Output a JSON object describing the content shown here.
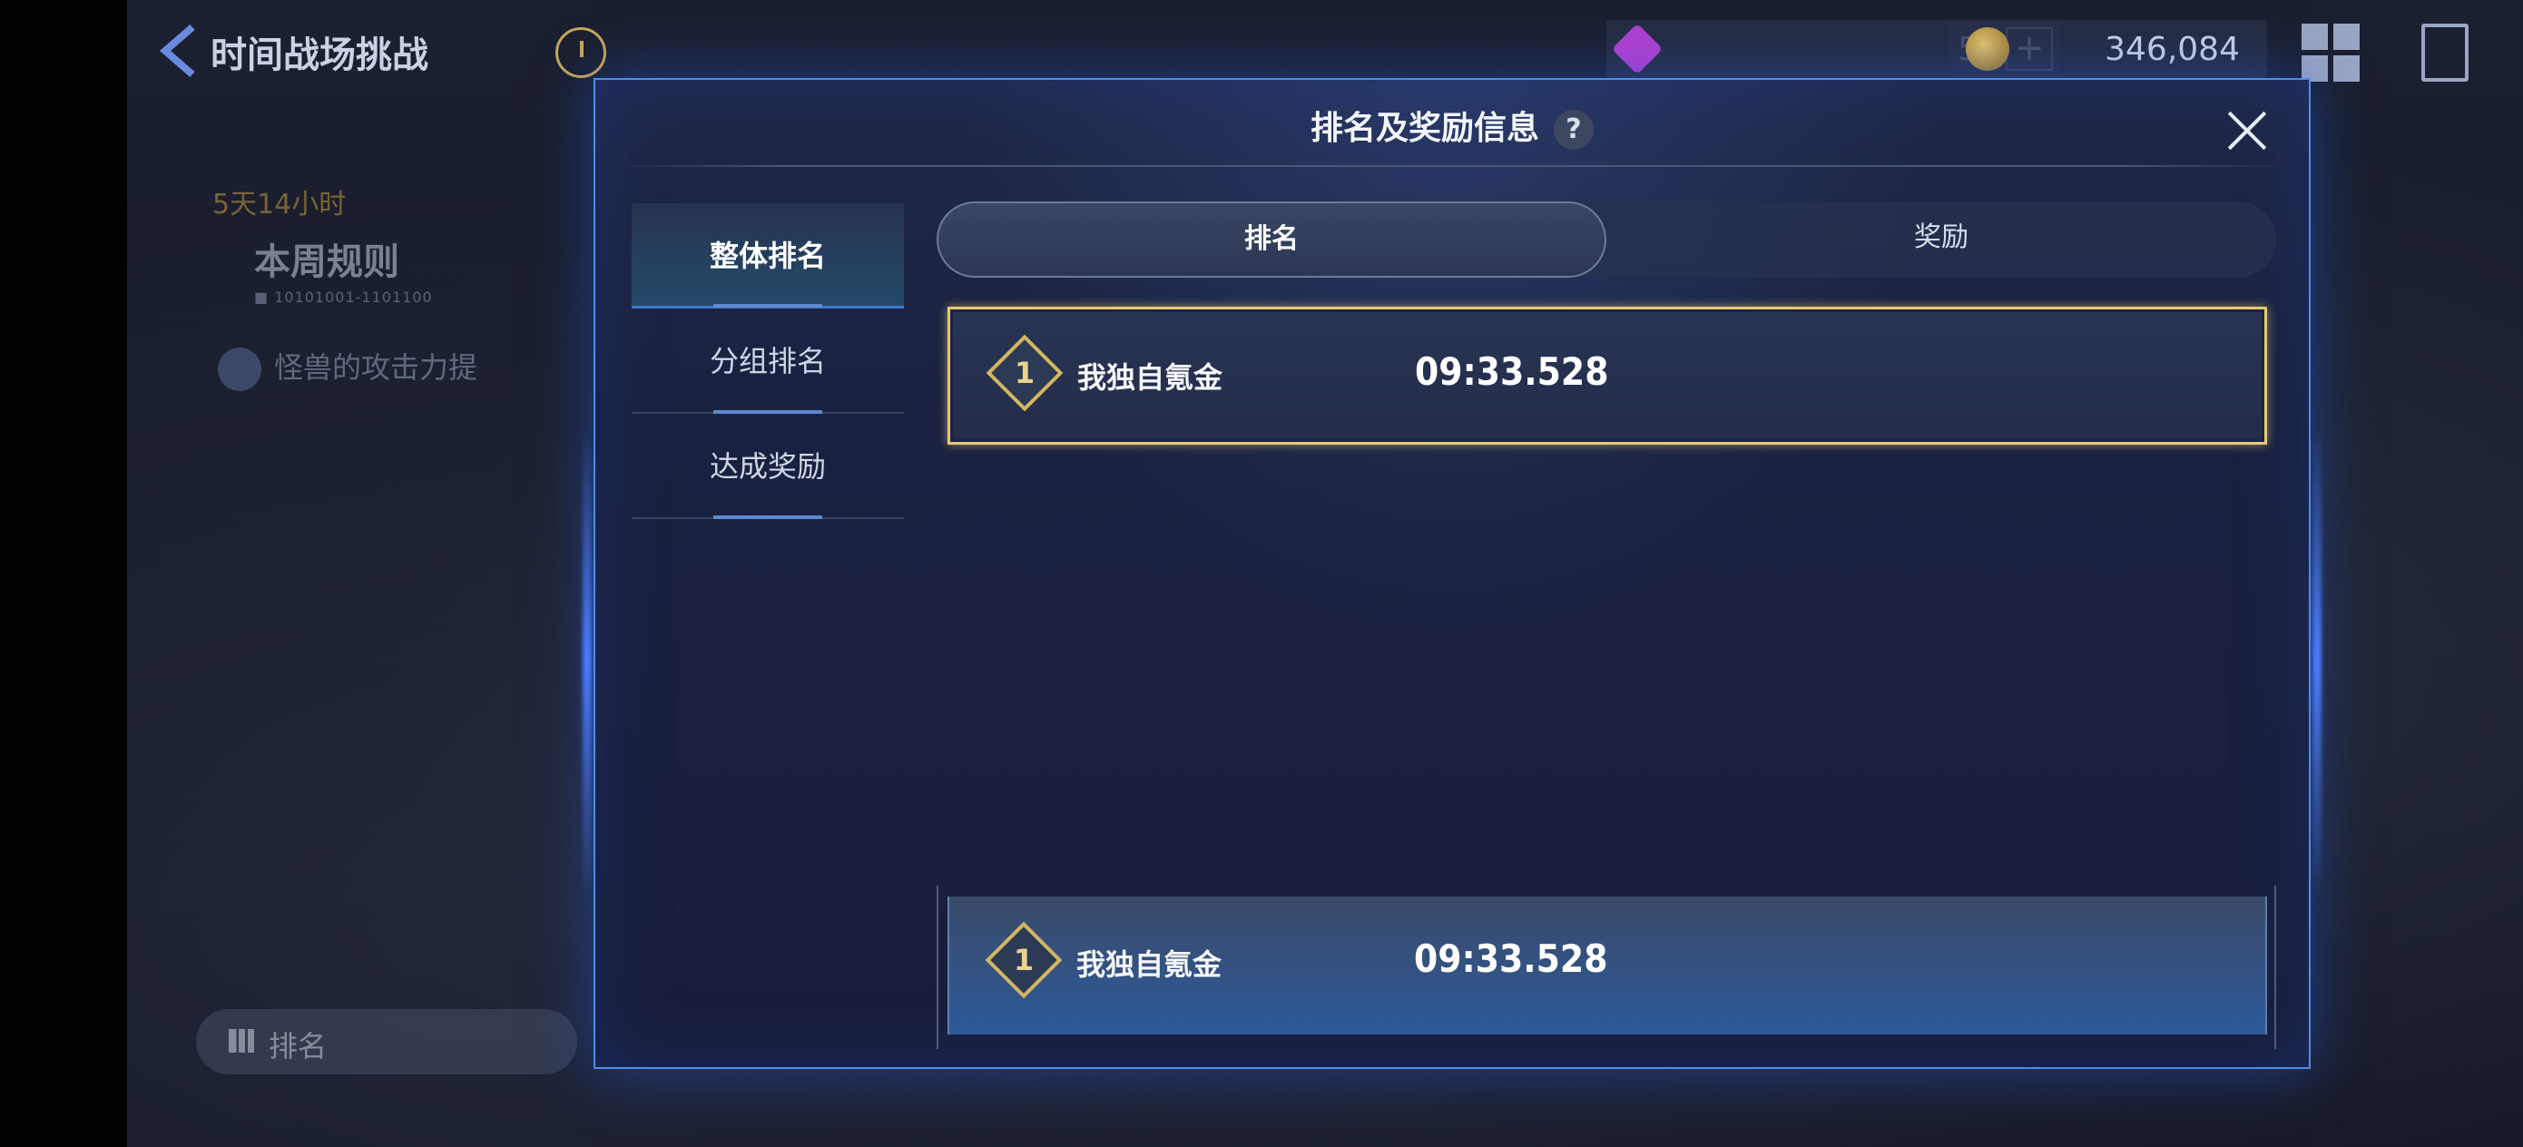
{
  "header": {
    "title": "时间战场挑战",
    "gem_count": "5",
    "plus_label": "+",
    "coin_count": "346,084"
  },
  "background": {
    "timer": "5天14小时",
    "rules_title": "本周规则",
    "rules_code": "■ 10101001-1101100",
    "monster_buff": "怪兽的攻击力提",
    "rank_button": "排名"
  },
  "modal": {
    "title": "排名及奖励信息",
    "help": "?",
    "side_menu": [
      {
        "label": "整体排名",
        "active": true
      },
      {
        "label": "分组排名",
        "active": false
      },
      {
        "label": "达成奖励",
        "active": false
      }
    ],
    "tabs": [
      {
        "label": "排名",
        "active": true
      },
      {
        "label": "奖励",
        "active": false
      }
    ],
    "top_entry": {
      "rank": "1",
      "name": "我独自氪金",
      "time": "09:33.528"
    },
    "my_entry": {
      "rank": "1",
      "name": "我独自氪金",
      "time": "09:33.528"
    }
  },
  "colors": {
    "accent_blue": "#4d8dea",
    "gold": "#e7c874",
    "timer_gold": "#c79d3e"
  }
}
